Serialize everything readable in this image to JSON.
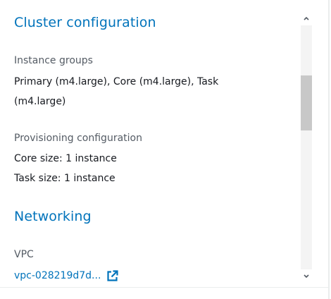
{
  "cluster_configuration": {
    "heading": "Cluster configuration",
    "instance_groups": {
      "label": "Instance groups",
      "value": "Primary (m4.large), Core (m4.large), Task (m4.large)"
    },
    "provisioning": {
      "label": "Provisioning configuration",
      "core_size": "Core size: 1 instance",
      "task_size": "Task size: 1 instance"
    }
  },
  "networking": {
    "heading": "Networking",
    "vpc": {
      "label": "VPC",
      "link_text": "vpc-028219d7d..."
    }
  },
  "icons": {
    "external_link": "external-link-icon",
    "scroll_up": "chevron-up-icon",
    "scroll_down": "chevron-down-icon"
  },
  "colors": {
    "heading": "#0073bb",
    "label": "#545b64",
    "value": "#16191f",
    "link": "#0073bb"
  }
}
